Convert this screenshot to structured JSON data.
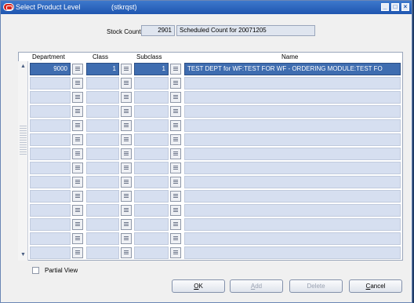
{
  "window": {
    "title": "Select Product Level",
    "code": "(stkrqst)",
    "controls": [
      "minimize",
      "maximize",
      "close"
    ]
  },
  "stock_count": {
    "label": "Stock Count",
    "number": "2901",
    "description": "Scheduled Count for 20071205"
  },
  "grid": {
    "headers": {
      "department": "Department",
      "class": "Class",
      "subclass": "Subclass",
      "name": "Name"
    },
    "rows": [
      {
        "department": "9000",
        "class": "1",
        "subclass": "1",
        "name": "TEST DEPT for WF:TEST FOR WF - ORDERING MODULE:TEST FO"
      },
      {
        "department": "",
        "class": "",
        "subclass": "",
        "name": ""
      },
      {
        "department": "",
        "class": "",
        "subclass": "",
        "name": ""
      },
      {
        "department": "",
        "class": "",
        "subclass": "",
        "name": ""
      },
      {
        "department": "",
        "class": "",
        "subclass": "",
        "name": ""
      },
      {
        "department": "",
        "class": "",
        "subclass": "",
        "name": ""
      },
      {
        "department": "",
        "class": "",
        "subclass": "",
        "name": ""
      },
      {
        "department": "",
        "class": "",
        "subclass": "",
        "name": ""
      },
      {
        "department": "",
        "class": "",
        "subclass": "",
        "name": ""
      },
      {
        "department": "",
        "class": "",
        "subclass": "",
        "name": ""
      },
      {
        "department": "",
        "class": "",
        "subclass": "",
        "name": ""
      },
      {
        "department": "",
        "class": "",
        "subclass": "",
        "name": ""
      },
      {
        "department": "",
        "class": "",
        "subclass": "",
        "name": ""
      },
      {
        "department": "",
        "class": "",
        "subclass": "",
        "name": ""
      }
    ]
  },
  "partial_view": {
    "label": "Partial View",
    "checked": false
  },
  "buttons": {
    "ok": {
      "first": "O",
      "rest": "K",
      "enabled": true
    },
    "add": {
      "first": "A",
      "rest": "dd",
      "enabled": false
    },
    "delete": {
      "first": "Delete",
      "rest": "",
      "enabled": false
    },
    "cancel": {
      "first": "C",
      "rest": "ancel",
      "enabled": true
    }
  },
  "colors": {
    "titlebar": "#1f56b0",
    "selected_cell": "#3f6db0",
    "cell": "#d6dff0",
    "window": "#f0f0f0"
  }
}
